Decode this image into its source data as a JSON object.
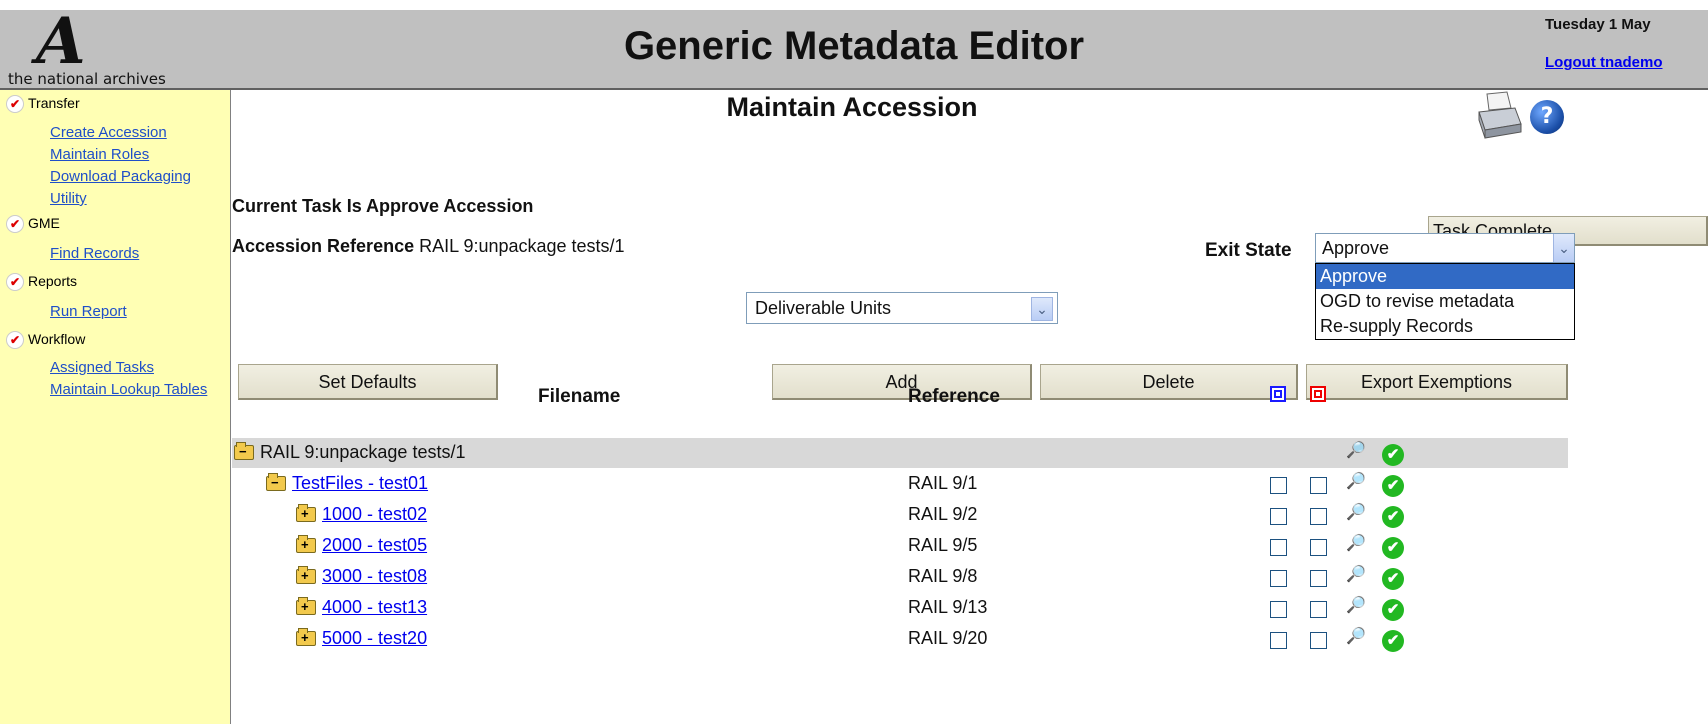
{
  "header": {
    "logo_letter": "A",
    "logo_text": "the national archives",
    "app_title": "Generic Metadata Editor",
    "date": "Tuesday 1 May",
    "logout": "Logout tnademo"
  },
  "sidebar": {
    "sections": [
      {
        "title": "Transfer",
        "links": [
          "Create Accession",
          "Maintain Roles",
          "Download Packaging",
          "Utility"
        ]
      },
      {
        "title": "GME",
        "links": [
          "Find Records"
        ]
      },
      {
        "title": "Reports",
        "links": [
          "Run Report"
        ]
      },
      {
        "title": "Workflow",
        "links": [
          "Assigned Tasks",
          "Maintain Lookup Tables"
        ]
      }
    ]
  },
  "main": {
    "page_title": "Maintain Accession",
    "current_task": "Current Task Is Approve Accession",
    "accession_ref_label": "Accession Reference",
    "accession_ref_value": "RAIL 9:unpackage tests/1",
    "task_complete_button": "Task Complete",
    "exit_state": {
      "label": "Exit State",
      "selected": "Approve",
      "options": [
        "Approve",
        "OGD to revise metadata",
        "Re-supply Records"
      ]
    },
    "unit_type_select": "Deliverable Units",
    "buttons": {
      "set_defaults": "Set Defaults",
      "add": "Add",
      "delete": "Delete",
      "export": "Export Exemptions"
    },
    "table": {
      "columns": [
        "Filename",
        "Reference"
      ],
      "rows": [
        {
          "name": "RAIL 9:unpackage tests/1",
          "reference": "",
          "folder": "open",
          "indent": 0,
          "link": false,
          "checkboxes": false
        },
        {
          "name": "TestFiles - test01",
          "reference": "RAIL 9/1",
          "folder": "open",
          "indent": 1,
          "link": true,
          "checkboxes": true
        },
        {
          "name": "1000 - test02",
          "reference": "RAIL 9/2",
          "folder": "plus",
          "indent": 2,
          "link": true,
          "checkboxes": true
        },
        {
          "name": "2000 - test05",
          "reference": "RAIL 9/5",
          "folder": "plus",
          "indent": 2,
          "link": true,
          "checkboxes": true
        },
        {
          "name": "3000 - test08",
          "reference": "RAIL 9/8",
          "folder": "plus",
          "indent": 2,
          "link": true,
          "checkboxes": true
        },
        {
          "name": "4000 - test13",
          "reference": "RAIL 9/13",
          "folder": "plus",
          "indent": 2,
          "link": true,
          "checkboxes": true
        },
        {
          "name": "5000 - test20",
          "reference": "RAIL 9/20",
          "folder": "plus",
          "indent": 2,
          "link": true,
          "checkboxes": true
        }
      ]
    }
  },
  "icons": {
    "chevron": "chevron-down-icon",
    "printer": "printer-icon",
    "help": "help-icon",
    "binoculars": "binoculars-icon",
    "check": "check-circle-icon"
  },
  "colors": {
    "header_bg": "#c0c0c0",
    "sidebar_bg": "#ffffb4",
    "link": "#1f4fc8",
    "selected_option": "#316ac5",
    "ok_green": "#22b822"
  }
}
